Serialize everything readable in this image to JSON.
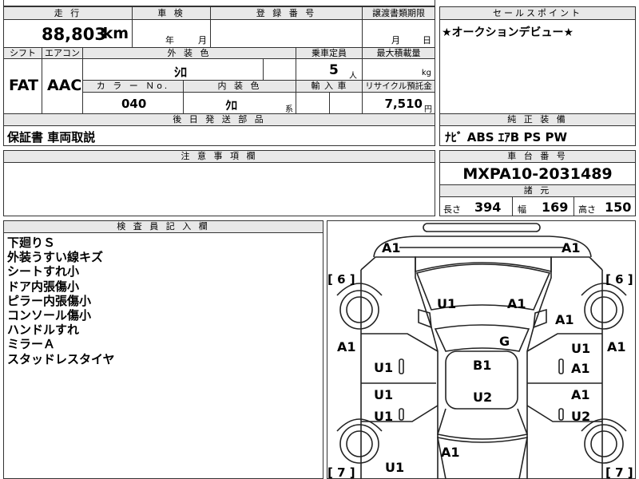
{
  "header": {
    "mileage_label": "走 行",
    "shaken_label": "車 検",
    "reg_label": "登 録 番 号",
    "transfer_label": "譲渡書類期限",
    "sales_label": "セールスポイント"
  },
  "mileage": {
    "value": "88,803",
    "unit": "km"
  },
  "shaken": {
    "year_unit": "年",
    "month_unit": "月"
  },
  "transfer": {
    "month_unit": "月",
    "day_unit": "日"
  },
  "sales_point": "★オークションデビュー★",
  "row2": {
    "shift_label": "シフト",
    "aircon_label": "エアコン",
    "exterior_label": "外 装 色",
    "capacity_label": "乗車定員",
    "max_load_label": "最大積載量",
    "shift": "FAT",
    "aircon": "AAC",
    "exterior_color": "ｼﾛ",
    "capacity": "5",
    "capacity_unit": "人",
    "load_unit": "kg",
    "color_no_label": "カ ラ ー Ｎo.",
    "interior_label": "内 装 色",
    "import_label": "輸 入 車",
    "recycle_label": "リサイクル預託金",
    "color_no": "040",
    "interior_color": "ｸﾛ",
    "interior_unit": "系",
    "recycle_fee": "7,510",
    "recycle_unit": "円"
  },
  "later_parts": {
    "label": "後 日 発 送 部 品",
    "value": "保証書 車両取説"
  },
  "equipment": {
    "label": "純 正 装 備",
    "value": "ﾅﾋﾞ ABS ｴｱB PS PW"
  },
  "caution": {
    "label": "注 意 事 項 欄"
  },
  "chassis": {
    "label": "車 台 番 号",
    "value": "MXPA10-2031489"
  },
  "specs": {
    "label": "諸 元",
    "length_label": "長さ",
    "length": "394",
    "width_label": "幅",
    "width": "169",
    "height_label": "高さ",
    "height": "150"
  },
  "inspector": {
    "label": "検 査 員 記 入 欄",
    "notes": [
      "下廻りＳ",
      "外装うすい線キズ",
      "シートすれ小",
      "ドア内張傷小",
      "ピラー内張傷小",
      "コンソール傷小",
      "ハンドルすれ",
      "ミラーＡ",
      "スタッドレスタイヤ"
    ]
  },
  "diagram": {
    "tire_fl": "[ 6 ]",
    "tire_fr": "[ 6 ]",
    "tire_rl": "[ 7 ]",
    "tire_rr": "[ 7 ]",
    "marks": [
      "A1",
      "A1",
      "U1",
      "A1",
      "A1",
      "A1",
      "G",
      "U1",
      "A1",
      "B1",
      "U1",
      "A1",
      "U1",
      "U2",
      "A1",
      "U1",
      "U2",
      "A1",
      "U1"
    ]
  }
}
